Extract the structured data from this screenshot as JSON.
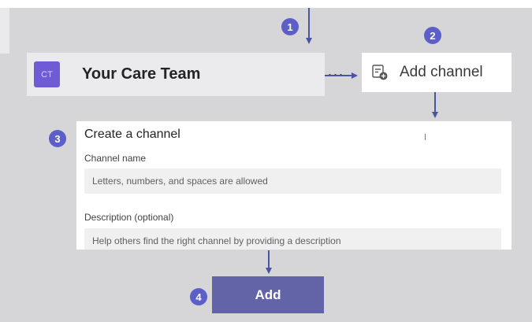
{
  "team": {
    "avatar_initials": "CT",
    "name": "Your Care Team",
    "more_label": "···"
  },
  "menu": {
    "add_channel_label": "Add channel",
    "icon": "add-channel-icon"
  },
  "dialog": {
    "title": "Create a channel",
    "channel_name_label": "Channel name",
    "channel_name_placeholder": "Letters, numbers, and spaces are allowed",
    "description_label": "Description (optional)",
    "description_placeholder": "Help others find the right channel by providing a description"
  },
  "action": {
    "add_label": "Add"
  },
  "steps": {
    "one": "1",
    "two": "2",
    "three": "3",
    "four": "4"
  },
  "colors": {
    "accent": "#5b5fc7",
    "button": "#6264a7",
    "avatar": "#6f5bd6",
    "background": "#d6d6d9"
  }
}
